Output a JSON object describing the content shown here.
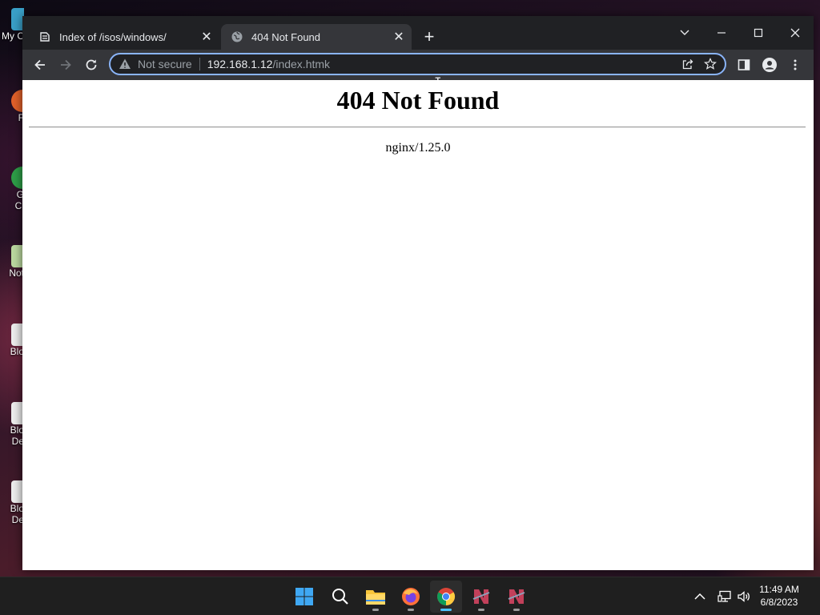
{
  "desktop": {
    "icons": [
      {
        "label": "My C",
        "color": "#3aa0c8"
      },
      {
        "label": "F",
        "color": "#e2612a"
      },
      {
        "label": "G",
        "label2": "Cl",
        "color": "#2e9e48"
      },
      {
        "label": "Not",
        "color": "#bcd9a0"
      },
      {
        "label": "Blo",
        "color": "#eeeeee"
      },
      {
        "label": "Blo",
        "label2": "De",
        "color": "#eeeeee"
      },
      {
        "label": "Blo",
        "label2": "De",
        "color": "#eeeeee"
      }
    ]
  },
  "browser": {
    "tabs": [
      {
        "title": "Index of /isos/windows/",
        "favicon": "server-favicon-icon",
        "active": false
      },
      {
        "title": "404 Not Found",
        "favicon": "globe-icon",
        "active": true
      }
    ],
    "address": {
      "security_label": "Not secure",
      "host": "192.168.1.12",
      "path": "/index.htmk"
    },
    "accent": "#8ab4f8"
  },
  "page": {
    "heading": "404 Not Found",
    "server": "nginx/1.25.0"
  },
  "taskbar": {
    "apps": [
      "windows-start-icon",
      "search-icon",
      "file-explorer-icon",
      "firefox-icon",
      "chrome-icon",
      "app-n-icon",
      "app-n-icon"
    ],
    "clock_time": "11:49 AM",
    "clock_date": "6/8/2023"
  }
}
